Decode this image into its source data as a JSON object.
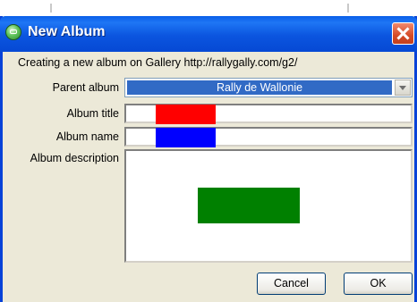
{
  "window": {
    "title": "New Album",
    "icon": "gallery-remote-icon",
    "close_icon": "close-icon"
  },
  "info_text": "Creating a new album on Gallery http://rallygally.com/g2/",
  "fields": {
    "parent_album_label": "Parent album",
    "parent_album_value": "Rally de Wallonie",
    "album_title_label": "Album title",
    "album_title_value": "",
    "album_name_label": "Album name",
    "album_name_value": "",
    "album_description_label": "Album description",
    "album_description_value": ""
  },
  "buttons": {
    "cancel": "Cancel",
    "ok": "OK"
  },
  "colors": {
    "titlebar": "#0a5fe8",
    "selection": "#316ac5",
    "redaction_title": "#ff0000",
    "redaction_name": "#0000ff",
    "redaction_description": "#008000"
  }
}
